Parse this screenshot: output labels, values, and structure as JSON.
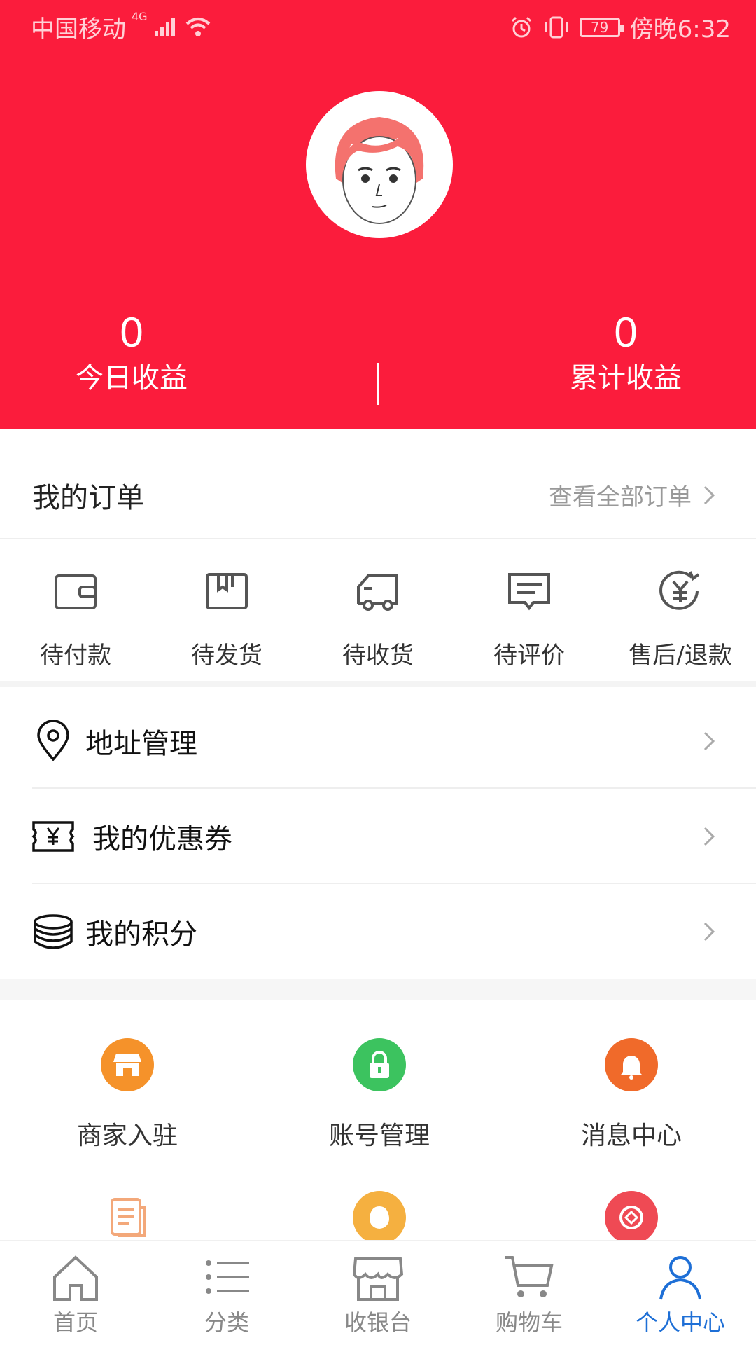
{
  "status_bar": {
    "carrier": "中国移动",
    "network": "4G",
    "battery": "79",
    "time": "傍晚6:32"
  },
  "profile": {
    "avatar_icon": "avatar-face-icon",
    "today_value": "0",
    "today_label": "今日收益",
    "total_value": "0",
    "total_label": "累计收益"
  },
  "orders": {
    "title": "我的订单",
    "view_all": "查看全部订单",
    "items": [
      {
        "label": "待付款",
        "icon": "wallet-icon"
      },
      {
        "label": "待发货",
        "icon": "package-icon"
      },
      {
        "label": "待收货",
        "icon": "truck-icon"
      },
      {
        "label": "待评价",
        "icon": "comment-icon"
      },
      {
        "label": "售后/退款",
        "icon": "refund-icon"
      }
    ]
  },
  "menu": {
    "items": [
      {
        "label": "地址管理",
        "icon": "location-pin-icon"
      },
      {
        "label": "我的优惠券",
        "icon": "coupon-icon"
      },
      {
        "label": "我的积分",
        "icon": "coins-stack-icon"
      }
    ]
  },
  "services": {
    "items": [
      {
        "label": "商家入驻",
        "icon": "store-icon",
        "color": "#f5922a"
      },
      {
        "label": "账号管理",
        "icon": "lock-icon",
        "color": "#3cc35f"
      },
      {
        "label": "消息中心",
        "icon": "bell-icon",
        "color": "#f06a2a"
      },
      {
        "label": "",
        "icon": "document-icon",
        "color": "#f3a87a"
      },
      {
        "label": "",
        "icon": "face-icon",
        "color": "#f5b040"
      },
      {
        "label": "",
        "icon": "exchange-icon",
        "color": "#ef4a54"
      }
    ]
  },
  "bottom_nav": {
    "items": [
      {
        "label": "首页",
        "icon": "home-icon",
        "active": false
      },
      {
        "label": "分类",
        "icon": "list-icon",
        "active": false
      },
      {
        "label": "收银台",
        "icon": "cashier-icon",
        "active": false
      },
      {
        "label": "购物车",
        "icon": "cart-icon",
        "active": false
      },
      {
        "label": "个人中心",
        "icon": "person-icon",
        "active": true
      }
    ]
  },
  "colors": {
    "header_red": "#fb1c3c",
    "active_blue": "#1e6fd6"
  }
}
